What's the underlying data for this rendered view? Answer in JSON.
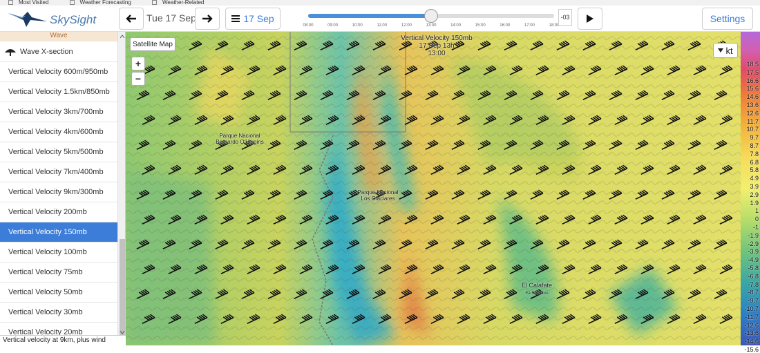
{
  "bookmarks": [
    "Most Visited",
    "Weather Forecasting",
    "Weather-Related"
  ],
  "app": {
    "name": "SkySight"
  },
  "nav": {
    "prev_icon": "arrow-left-icon",
    "date": "Tue 17 Sep",
    "next_icon": "arrow-right-icon",
    "menu_date": "17 Sep",
    "timezone": "-03",
    "play_icon": "play-icon",
    "settings": "Settings"
  },
  "timeline": {
    "ticks": [
      "08:00",
      "09:00",
      "10:00",
      "11:00",
      "12:00",
      "13:00",
      "14:00",
      "15:00",
      "16:00",
      "17:00",
      "18:00"
    ],
    "value": 0.5
  },
  "sidebar": {
    "header": "Wave",
    "xsection": "Wave X-section",
    "items": [
      "Vertical Velocity 600m/950mb",
      "Vertical Velocity 1.5km/850mb",
      "Vertical Velocity 3km/700mb",
      "Vertical Velocity 4km/600mb",
      "Vertical Velocity 5km/500mb",
      "Vertical Velocity 7km/400mb",
      "Vertical Velocity 9km/300mb",
      "Vertical Velocity 200mb",
      "Vertical Velocity 150mb",
      "Vertical Velocity 100mb",
      "Vertical Velocity 75mb",
      "Vertical Velocity 50mb",
      "Vertical Velocity 30mb",
      "Vertical Velocity 20mb"
    ],
    "active_index": 8,
    "footer": "Vertical velocity at 9km, plus wind"
  },
  "map": {
    "satellite_btn": "Satellite Map",
    "zoom_in": "+",
    "zoom_out": "−",
    "title_line1": "Vertical Velocity 150mb",
    "title_line2": "17 Sep 13h",
    "title_line3": "13:00",
    "units_btn": "kt",
    "places": [
      "Parque Nacional Bernardo O'Higgins",
      "Parque Nacional Los Glaciares",
      "El Calafate",
      "Ea Ruimtore"
    ]
  },
  "legend": {
    "values": [
      "18.5",
      "17.5",
      "16.6",
      "15.6",
      "14.6",
      "13.6",
      "12.6",
      "11.7",
      "10.7",
      "9.7",
      "8.7",
      "7.8",
      "6.8",
      "5.8",
      "4.9",
      "3.9",
      "2.9",
      "1.9",
      "1",
      "0",
      "-1",
      "-1.9",
      "-2.9",
      "-3.9",
      "-4.9",
      "-5.8",
      "-6.8",
      "-7.8",
      "-8.7",
      "-9.7",
      "-10.7",
      "-11.7",
      "-12.6",
      "-13.6",
      "-14.6",
      "-15.6"
    ]
  }
}
